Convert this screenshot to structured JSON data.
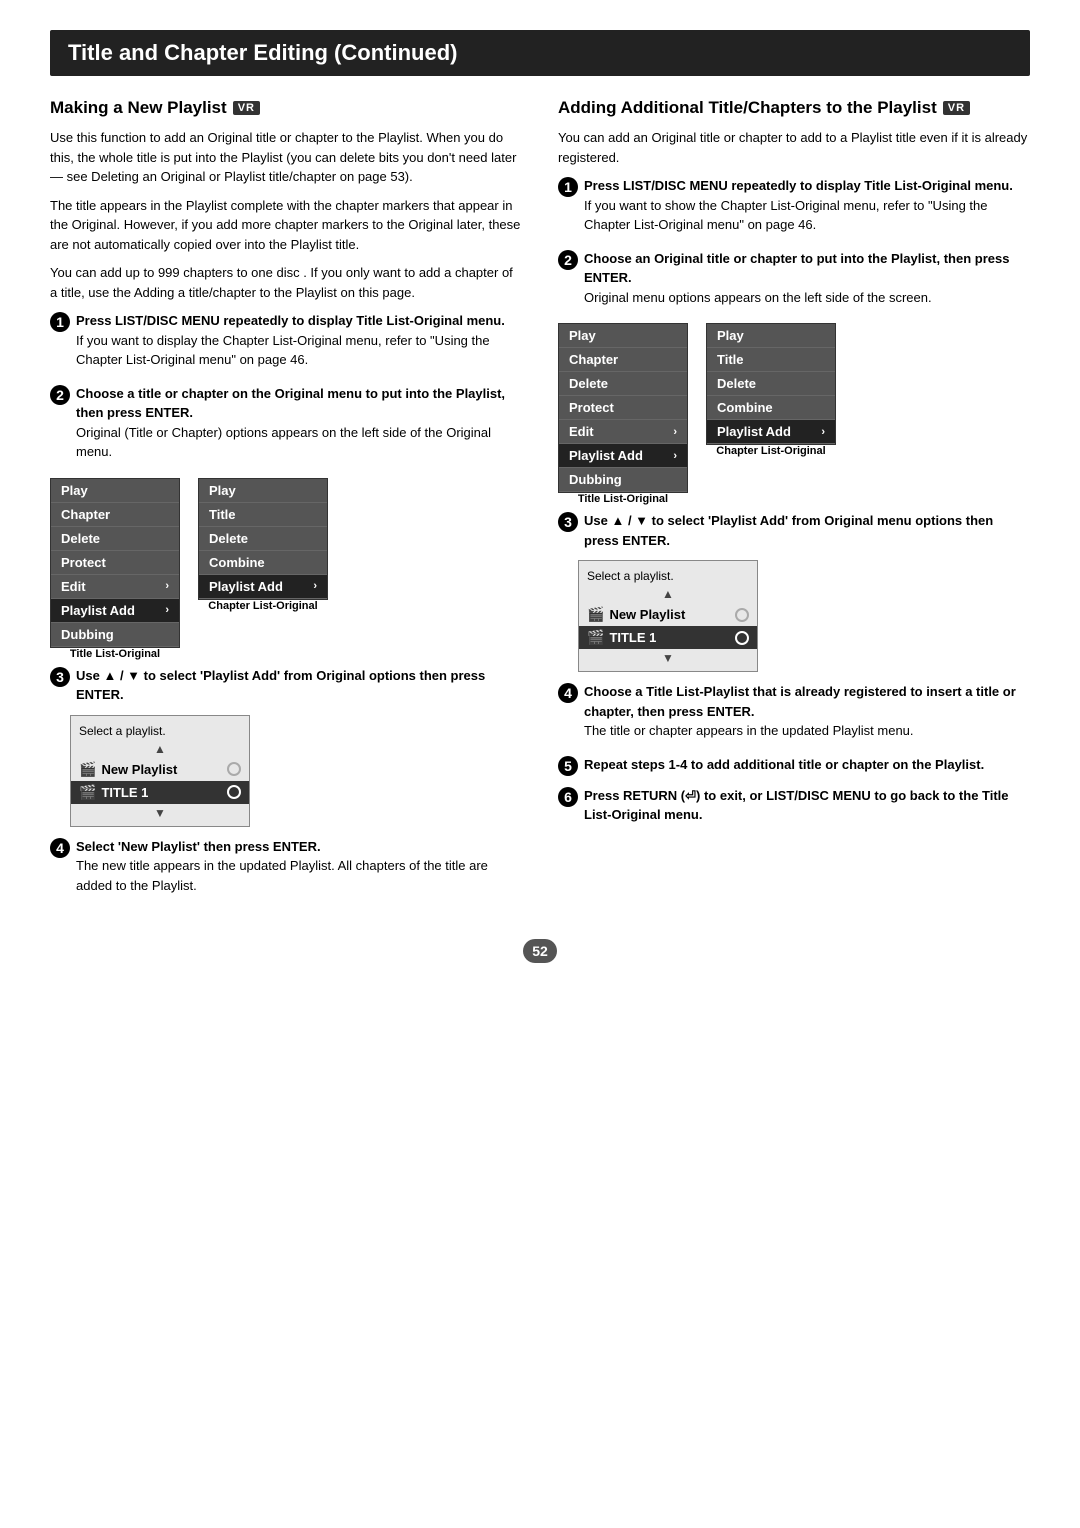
{
  "page": {
    "title": "Title and Chapter Editing (Continued)",
    "page_number": "52"
  },
  "left_section": {
    "heading": "Making a New Playlist",
    "vr_badge": "VR",
    "intro_paragraphs": [
      "Use this function to add an Original title or chapter to the Playlist. When you do this, the whole title is put into the Playlist (you can delete bits you don't need later — see Deleting an Original or Playlist title/chapter on page 53).",
      "The title appears in the Playlist complete with the chapter markers that appear in the Original. However, if you add more chapter markers to the Original later, these are not automatically copied over into the Playlist title.",
      "You can add up to 999 chapters to one disc . If you only want to add a chapter of a title, use the Adding a title/chapter to the Playlist on this page."
    ],
    "steps": [
      {
        "num": "1",
        "bold": "Press LIST/DISC MENU repeatedly to display Title List-Original menu.",
        "text": "If you want to display the Chapter List-Original menu, refer to \"Using the Chapter List-Original menu\" on page 46."
      },
      {
        "num": "2",
        "bold": "Choose a title or chapter on the Original menu to put into the Playlist, then press ENTER.",
        "text": "Original (Title or Chapter) options appears on the left side of the Original menu."
      }
    ],
    "menu_left": {
      "items": [
        {
          "label": "Play",
          "highlighted": false
        },
        {
          "label": "Chapter",
          "highlighted": false
        },
        {
          "label": "Delete",
          "highlighted": false
        },
        {
          "label": "Protect",
          "highlighted": false
        },
        {
          "label": "Edit",
          "highlighted": false,
          "arrow": "›"
        },
        {
          "label": "Playlist Add",
          "highlighted": true,
          "arrow": "›"
        },
        {
          "label": "Dubbing",
          "highlighted": false
        }
      ],
      "caption": "Title List-Original"
    },
    "menu_right": {
      "items": [
        {
          "label": "Play",
          "highlighted": false
        },
        {
          "label": "Title",
          "highlighted": false
        },
        {
          "label": "Delete",
          "highlighted": false
        },
        {
          "label": "Combine",
          "highlighted": false
        },
        {
          "label": "Playlist Add",
          "highlighted": true,
          "arrow": "›"
        }
      ],
      "caption": "Chapter List-Original"
    },
    "step3": {
      "num": "3",
      "bold": "Use ▲ / ▼ to select 'Playlist Add' from Original options then press ENTER."
    },
    "playlist_selector": {
      "label": "Select a playlist.",
      "items": [
        {
          "icon": "🎬",
          "label": "New Playlist",
          "highlighted": false,
          "circle": true
        },
        {
          "icon": "🎬",
          "label": "TITLE 1",
          "highlighted": true,
          "circle": true
        }
      ]
    },
    "step4": {
      "num": "4",
      "bold": "Select 'New Playlist' then press ENTER.",
      "text": "The new title appears in the updated Playlist. All chapters of the title are added to the Playlist."
    }
  },
  "right_section": {
    "heading": "Adding Additional Title/Chapters to the Playlist",
    "vr_badge": "VR",
    "intro": "You can add an Original title or chapter to add to a Playlist title even if it is already registered.",
    "steps": [
      {
        "num": "1",
        "bold": "Press LIST/DISC MENU repeatedly to display Title List-Original menu.",
        "text": "If you want to show the Chapter List-Original menu, refer to \"Using the Chapter List-Original menu\" on page 46."
      },
      {
        "num": "2",
        "bold": "Choose an Original title or chapter to put into the Playlist, then press ENTER.",
        "text": "Original menu options appears on the left side of the screen."
      }
    ],
    "menu_left": {
      "items": [
        {
          "label": "Play",
          "highlighted": false
        },
        {
          "label": "Chapter",
          "highlighted": false
        },
        {
          "label": "Delete",
          "highlighted": false
        },
        {
          "label": "Protect",
          "highlighted": false
        },
        {
          "label": "Edit",
          "highlighted": false,
          "arrow": "›"
        },
        {
          "label": "Playlist Add",
          "highlighted": true,
          "arrow": "›"
        },
        {
          "label": "Dubbing",
          "highlighted": false
        }
      ],
      "caption": "Title List-Original"
    },
    "menu_right": {
      "items": [
        {
          "label": "Play",
          "highlighted": false
        },
        {
          "label": "Title",
          "highlighted": false
        },
        {
          "label": "Delete",
          "highlighted": false
        },
        {
          "label": "Combine",
          "highlighted": false
        },
        {
          "label": "Playlist Add",
          "highlighted": true,
          "arrow": "›"
        }
      ],
      "caption": "Chapter List-Original"
    },
    "step3": {
      "num": "3",
      "bold": "Use ▲ / ▼ to select 'Playlist Add' from Original menu options then press ENTER."
    },
    "playlist_selector": {
      "label": "Select a playlist.",
      "items": [
        {
          "icon": "🎬",
          "label": "New Playlist",
          "highlighted": false,
          "circle": true
        },
        {
          "icon": "🎬",
          "label": "TITLE 1",
          "highlighted": true,
          "circle": true
        }
      ]
    },
    "step4": {
      "num": "4",
      "bold": "Choose a Title List-Playlist that is already registered to insert a title or chapter, then press ENTER.",
      "text": "The title or chapter appears in the updated Playlist menu."
    },
    "step5": {
      "num": "5",
      "bold": "Repeat steps 1-4 to add additional title or chapter on the Playlist."
    },
    "step6": {
      "num": "6",
      "bold": "Press RETURN (⏎) to exit, or LIST/DISC MENU to go back to the Title List-Original menu."
    }
  }
}
